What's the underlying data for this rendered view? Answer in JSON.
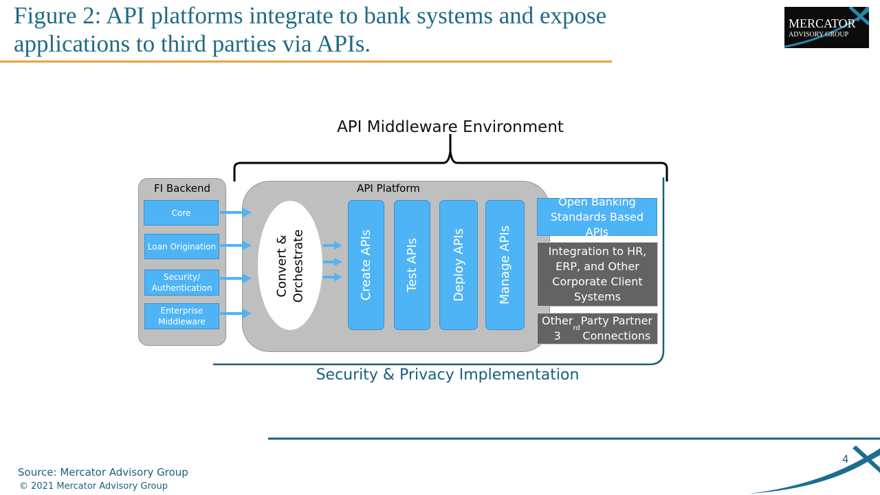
{
  "title": "Figure 2: API platforms integrate to bank systems and expose applications to third parties via APIs.",
  "logo": {
    "line1": "MERCATOR",
    "line2": "ADVISORY GROUP"
  },
  "diagram": {
    "environment_label": "API Middleware Environment",
    "backend": {
      "title": "FI Backend",
      "items": [
        "Core",
        "Loan Origination",
        "Security/ Authentication",
        "Enterprise Middleware"
      ]
    },
    "platform": {
      "title": "API Platform",
      "orchestrate": "Convert & Orchestrate",
      "stages": [
        "Create APIs",
        "Test APIs",
        "Deploy APIs",
        "Manage APIs"
      ]
    },
    "outputs": [
      "Open Banking Standards Based APIs",
      "Integration to HR, ERP, and Other Corporate Client Systems",
      "Other 3rd Party Partner Connections"
    ],
    "security_label": "Security & Privacy Implementation"
  },
  "colors": {
    "title": "#1f6a87",
    "accent_line": "#e8a33d",
    "box_blue": "#4fb4f5",
    "box_gray": "#bfbfbf",
    "box_dark": "#636363",
    "teal": "#17607a"
  },
  "footer": {
    "page_number": "4",
    "source": "Source: Mercator Advisory Group",
    "copyright": "© 2021 Mercator Advisory Group"
  }
}
